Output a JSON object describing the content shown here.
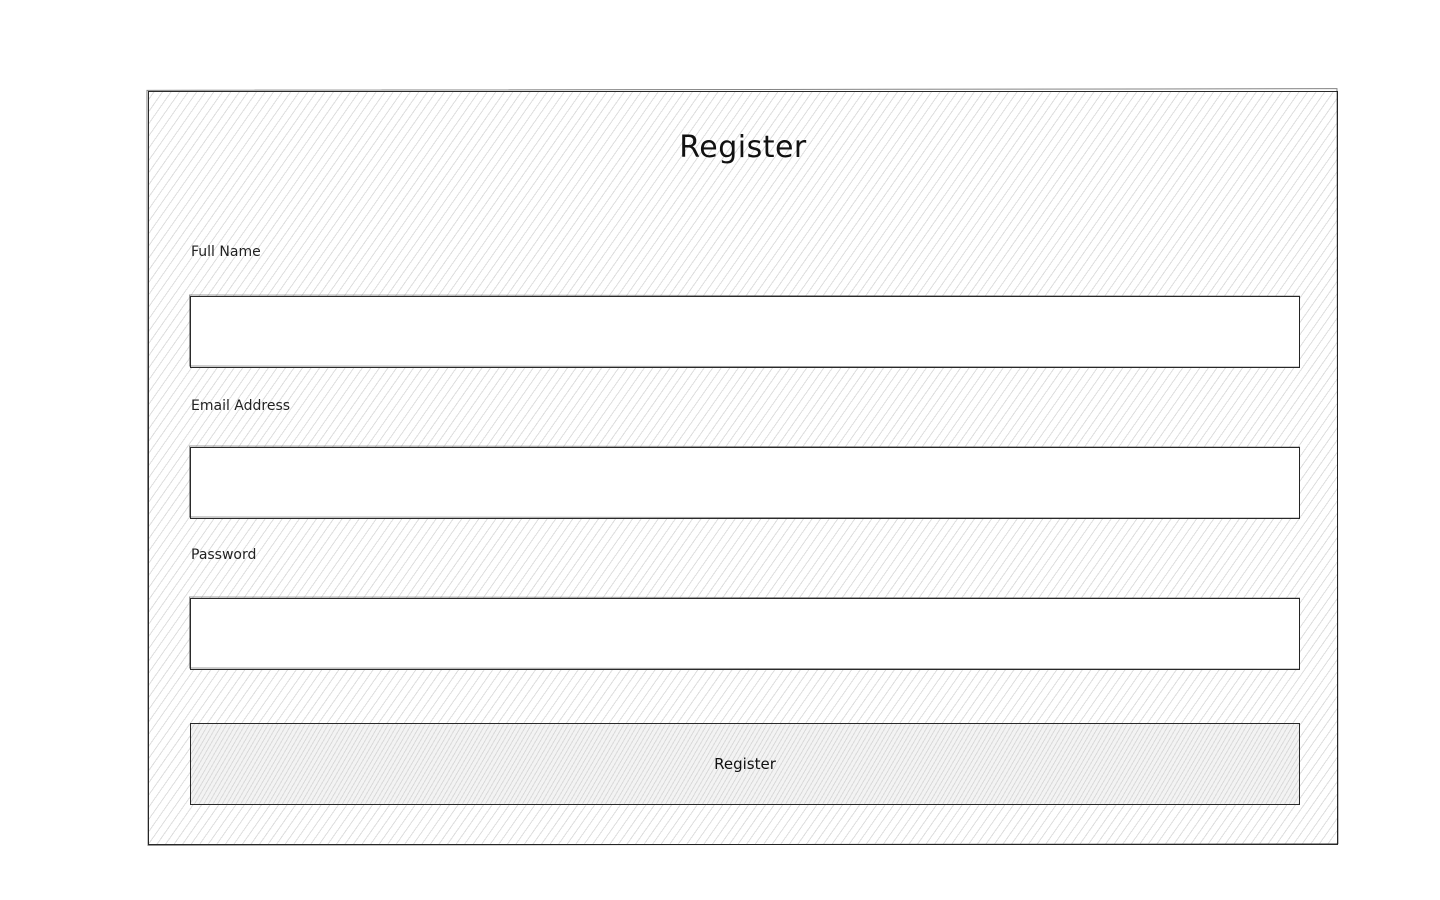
{
  "form": {
    "title": "Register",
    "fields": [
      {
        "label": "Full Name",
        "value": "",
        "placeholder": ""
      },
      {
        "label": "Email Address",
        "value": "",
        "placeholder": ""
      },
      {
        "label": "Password",
        "value": "",
        "placeholder": ""
      }
    ],
    "submit_label": "Register"
  }
}
